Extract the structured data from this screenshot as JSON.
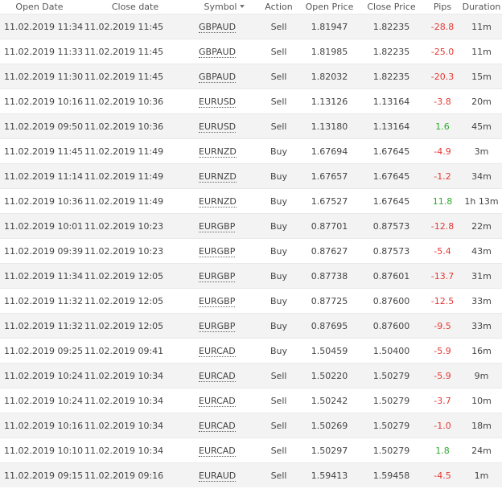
{
  "columns": {
    "open_date": "Open Date",
    "close_date": "Close date",
    "symbol": "Symbol",
    "action": "Action",
    "open_price": "Open Price",
    "close_price": "Close Price",
    "pips": "Pips",
    "duration": "Duration"
  },
  "sort": {
    "column": "symbol",
    "direction": "descending",
    "indicator_icon": "caret-down-icon"
  },
  "colors": {
    "pips_negative": "#e53935",
    "pips_positive": "#2eaa2e",
    "row_alt": "#f3f3f3"
  },
  "rows": [
    {
      "open_date": "11.02.2019 11:34",
      "close_date": "11.02.2019 11:45",
      "symbol": "GBPAUD",
      "action": "Sell",
      "open_price": "1.81947",
      "close_price": "1.82235",
      "pips": "-28.8",
      "duration": "11m"
    },
    {
      "open_date": "11.02.2019 11:33",
      "close_date": "11.02.2019 11:45",
      "symbol": "GBPAUD",
      "action": "Sell",
      "open_price": "1.81985",
      "close_price": "1.82235",
      "pips": "-25.0",
      "duration": "11m"
    },
    {
      "open_date": "11.02.2019 11:30",
      "close_date": "11.02.2019 11:45",
      "symbol": "GBPAUD",
      "action": "Sell",
      "open_price": "1.82032",
      "close_price": "1.82235",
      "pips": "-20.3",
      "duration": "15m"
    },
    {
      "open_date": "11.02.2019 10:16",
      "close_date": "11.02.2019 10:36",
      "symbol": "EURUSD",
      "action": "Sell",
      "open_price": "1.13126",
      "close_price": "1.13164",
      "pips": "-3.8",
      "duration": "20m"
    },
    {
      "open_date": "11.02.2019 09:50",
      "close_date": "11.02.2019 10:36",
      "symbol": "EURUSD",
      "action": "Sell",
      "open_price": "1.13180",
      "close_price": "1.13164",
      "pips": "1.6",
      "duration": "45m"
    },
    {
      "open_date": "11.02.2019 11:45",
      "close_date": "11.02.2019 11:49",
      "symbol": "EURNZD",
      "action": "Buy",
      "open_price": "1.67694",
      "close_price": "1.67645",
      "pips": "-4.9",
      "duration": "3m"
    },
    {
      "open_date": "11.02.2019 11:14",
      "close_date": "11.02.2019 11:49",
      "symbol": "EURNZD",
      "action": "Buy",
      "open_price": "1.67657",
      "close_price": "1.67645",
      "pips": "-1.2",
      "duration": "34m"
    },
    {
      "open_date": "11.02.2019 10:36",
      "close_date": "11.02.2019 11:49",
      "symbol": "EURNZD",
      "action": "Buy",
      "open_price": "1.67527",
      "close_price": "1.67645",
      "pips": "11.8",
      "duration": "1h 13m"
    },
    {
      "open_date": "11.02.2019 10:01",
      "close_date": "11.02.2019 10:23",
      "symbol": "EURGBP",
      "action": "Buy",
      "open_price": "0.87701",
      "close_price": "0.87573",
      "pips": "-12.8",
      "duration": "22m"
    },
    {
      "open_date": "11.02.2019 09:39",
      "close_date": "11.02.2019 10:23",
      "symbol": "EURGBP",
      "action": "Buy",
      "open_price": "0.87627",
      "close_price": "0.87573",
      "pips": "-5.4",
      "duration": "43m"
    },
    {
      "open_date": "11.02.2019 11:34",
      "close_date": "11.02.2019 12:05",
      "symbol": "EURGBP",
      "action": "Buy",
      "open_price": "0.87738",
      "close_price": "0.87601",
      "pips": "-13.7",
      "duration": "31m"
    },
    {
      "open_date": "11.02.2019 11:32",
      "close_date": "11.02.2019 12:05",
      "symbol": "EURGBP",
      "action": "Buy",
      "open_price": "0.87725",
      "close_price": "0.87600",
      "pips": "-12.5",
      "duration": "33m"
    },
    {
      "open_date": "11.02.2019 11:32",
      "close_date": "11.02.2019 12:05",
      "symbol": "EURGBP",
      "action": "Buy",
      "open_price": "0.87695",
      "close_price": "0.87600",
      "pips": "-9.5",
      "duration": "33m"
    },
    {
      "open_date": "11.02.2019 09:25",
      "close_date": "11.02.2019 09:41",
      "symbol": "EURCAD",
      "action": "Buy",
      "open_price": "1.50459",
      "close_price": "1.50400",
      "pips": "-5.9",
      "duration": "16m"
    },
    {
      "open_date": "11.02.2019 10:24",
      "close_date": "11.02.2019 10:34",
      "symbol": "EURCAD",
      "action": "Sell",
      "open_price": "1.50220",
      "close_price": "1.50279",
      "pips": "-5.9",
      "duration": "9m"
    },
    {
      "open_date": "11.02.2019 10:24",
      "close_date": "11.02.2019 10:34",
      "symbol": "EURCAD",
      "action": "Sell",
      "open_price": "1.50242",
      "close_price": "1.50279",
      "pips": "-3.7",
      "duration": "10m"
    },
    {
      "open_date": "11.02.2019 10:16",
      "close_date": "11.02.2019 10:34",
      "symbol": "EURCAD",
      "action": "Sell",
      "open_price": "1.50269",
      "close_price": "1.50279",
      "pips": "-1.0",
      "duration": "18m"
    },
    {
      "open_date": "11.02.2019 10:10",
      "close_date": "11.02.2019 10:34",
      "symbol": "EURCAD",
      "action": "Sell",
      "open_price": "1.50297",
      "close_price": "1.50279",
      "pips": "1.8",
      "duration": "24m"
    },
    {
      "open_date": "11.02.2019 09:15",
      "close_date": "11.02.2019 09:16",
      "symbol": "EURAUD",
      "action": "Sell",
      "open_price": "1.59413",
      "close_price": "1.59458",
      "pips": "-4.5",
      "duration": "1m"
    }
  ]
}
